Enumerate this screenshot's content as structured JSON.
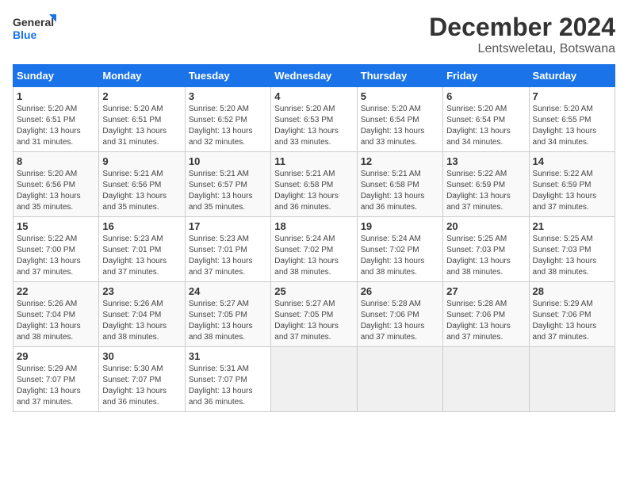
{
  "header": {
    "logo_line1": "General",
    "logo_line2": "Blue",
    "month": "December 2024",
    "location": "Lentsweletau, Botswana"
  },
  "weekdays": [
    "Sunday",
    "Monday",
    "Tuesday",
    "Wednesday",
    "Thursday",
    "Friday",
    "Saturday"
  ],
  "weeks": [
    [
      {
        "day": "1",
        "sunrise": "5:20 AM",
        "sunset": "6:51 PM",
        "daylight": "13 hours and 31 minutes."
      },
      {
        "day": "2",
        "sunrise": "5:20 AM",
        "sunset": "6:51 PM",
        "daylight": "13 hours and 31 minutes."
      },
      {
        "day": "3",
        "sunrise": "5:20 AM",
        "sunset": "6:52 PM",
        "daylight": "13 hours and 32 minutes."
      },
      {
        "day": "4",
        "sunrise": "5:20 AM",
        "sunset": "6:53 PM",
        "daylight": "13 hours and 33 minutes."
      },
      {
        "day": "5",
        "sunrise": "5:20 AM",
        "sunset": "6:54 PM",
        "daylight": "13 hours and 33 minutes."
      },
      {
        "day": "6",
        "sunrise": "5:20 AM",
        "sunset": "6:54 PM",
        "daylight": "13 hours and 34 minutes."
      },
      {
        "day": "7",
        "sunrise": "5:20 AM",
        "sunset": "6:55 PM",
        "daylight": "13 hours and 34 minutes."
      }
    ],
    [
      {
        "day": "8",
        "sunrise": "5:20 AM",
        "sunset": "6:56 PM",
        "daylight": "13 hours and 35 minutes."
      },
      {
        "day": "9",
        "sunrise": "5:21 AM",
        "sunset": "6:56 PM",
        "daylight": "13 hours and 35 minutes."
      },
      {
        "day": "10",
        "sunrise": "5:21 AM",
        "sunset": "6:57 PM",
        "daylight": "13 hours and 35 minutes."
      },
      {
        "day": "11",
        "sunrise": "5:21 AM",
        "sunset": "6:58 PM",
        "daylight": "13 hours and 36 minutes."
      },
      {
        "day": "12",
        "sunrise": "5:21 AM",
        "sunset": "6:58 PM",
        "daylight": "13 hours and 36 minutes."
      },
      {
        "day": "13",
        "sunrise": "5:22 AM",
        "sunset": "6:59 PM",
        "daylight": "13 hours and 37 minutes."
      },
      {
        "day": "14",
        "sunrise": "5:22 AM",
        "sunset": "6:59 PM",
        "daylight": "13 hours and 37 minutes."
      }
    ],
    [
      {
        "day": "15",
        "sunrise": "5:22 AM",
        "sunset": "7:00 PM",
        "daylight": "13 hours and 37 minutes."
      },
      {
        "day": "16",
        "sunrise": "5:23 AM",
        "sunset": "7:01 PM",
        "daylight": "13 hours and 37 minutes."
      },
      {
        "day": "17",
        "sunrise": "5:23 AM",
        "sunset": "7:01 PM",
        "daylight": "13 hours and 37 minutes."
      },
      {
        "day": "18",
        "sunrise": "5:24 AM",
        "sunset": "7:02 PM",
        "daylight": "13 hours and 38 minutes."
      },
      {
        "day": "19",
        "sunrise": "5:24 AM",
        "sunset": "7:02 PM",
        "daylight": "13 hours and 38 minutes."
      },
      {
        "day": "20",
        "sunrise": "5:25 AM",
        "sunset": "7:03 PM",
        "daylight": "13 hours and 38 minutes."
      },
      {
        "day": "21",
        "sunrise": "5:25 AM",
        "sunset": "7:03 PM",
        "daylight": "13 hours and 38 minutes."
      }
    ],
    [
      {
        "day": "22",
        "sunrise": "5:26 AM",
        "sunset": "7:04 PM",
        "daylight": "13 hours and 38 minutes."
      },
      {
        "day": "23",
        "sunrise": "5:26 AM",
        "sunset": "7:04 PM",
        "daylight": "13 hours and 38 minutes."
      },
      {
        "day": "24",
        "sunrise": "5:27 AM",
        "sunset": "7:05 PM",
        "daylight": "13 hours and 38 minutes."
      },
      {
        "day": "25",
        "sunrise": "5:27 AM",
        "sunset": "7:05 PM",
        "daylight": "13 hours and 37 minutes."
      },
      {
        "day": "26",
        "sunrise": "5:28 AM",
        "sunset": "7:06 PM",
        "daylight": "13 hours and 37 minutes."
      },
      {
        "day": "27",
        "sunrise": "5:28 AM",
        "sunset": "7:06 PM",
        "daylight": "13 hours and 37 minutes."
      },
      {
        "day": "28",
        "sunrise": "5:29 AM",
        "sunset": "7:06 PM",
        "daylight": "13 hours and 37 minutes."
      }
    ],
    [
      {
        "day": "29",
        "sunrise": "5:29 AM",
        "sunset": "7:07 PM",
        "daylight": "13 hours and 37 minutes."
      },
      {
        "day": "30",
        "sunrise": "5:30 AM",
        "sunset": "7:07 PM",
        "daylight": "13 hours and 36 minutes."
      },
      {
        "day": "31",
        "sunrise": "5:31 AM",
        "sunset": "7:07 PM",
        "daylight": "13 hours and 36 minutes."
      },
      null,
      null,
      null,
      null
    ]
  ]
}
